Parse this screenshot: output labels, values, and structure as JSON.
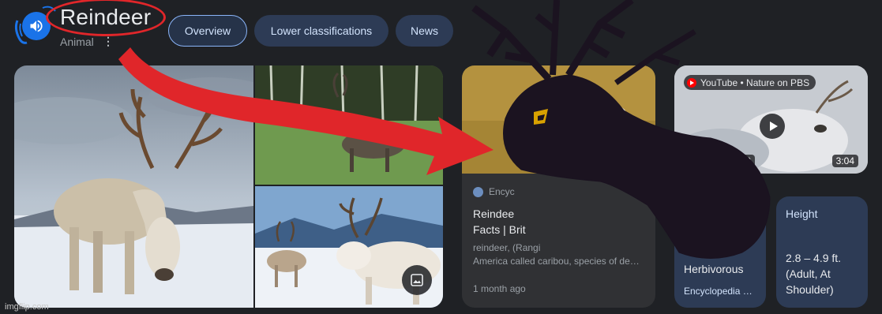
{
  "header": {
    "title": "Reindeer",
    "subtitle": "Animal",
    "more_glyph": "⋮",
    "speaker_icon": "volume-up-icon"
  },
  "tabs": [
    {
      "label": "Overview",
      "active": true
    },
    {
      "label": "Lower classifications",
      "active": false
    },
    {
      "label": "News",
      "active": false
    }
  ],
  "article": {
    "source": "Encyc",
    "title": "Reindee\nFacts | Brit",
    "snippet": "reindeer, (Rangi\nAmerica called caribou, species of de…",
    "date": "1 month ago"
  },
  "video": {
    "source": "YouTube • Nature on PBS",
    "date": "0, 2020",
    "duration": "3:04"
  },
  "facts": [
    {
      "heading": "",
      "value": "Herbivorous",
      "source": "Encyclopedia …"
    },
    {
      "heading": "Height",
      "value": "2.8 – 4.9 ft. (Adult, At Shoulder)",
      "source": ""
    }
  ],
  "watermark": "imgflip.com",
  "colors": {
    "background": "#1f2125",
    "accent_blue": "#1a73e8",
    "tab_bg": "#2d3b55",
    "annotation_red": "#e0262a",
    "scribble": "#1b1320"
  }
}
